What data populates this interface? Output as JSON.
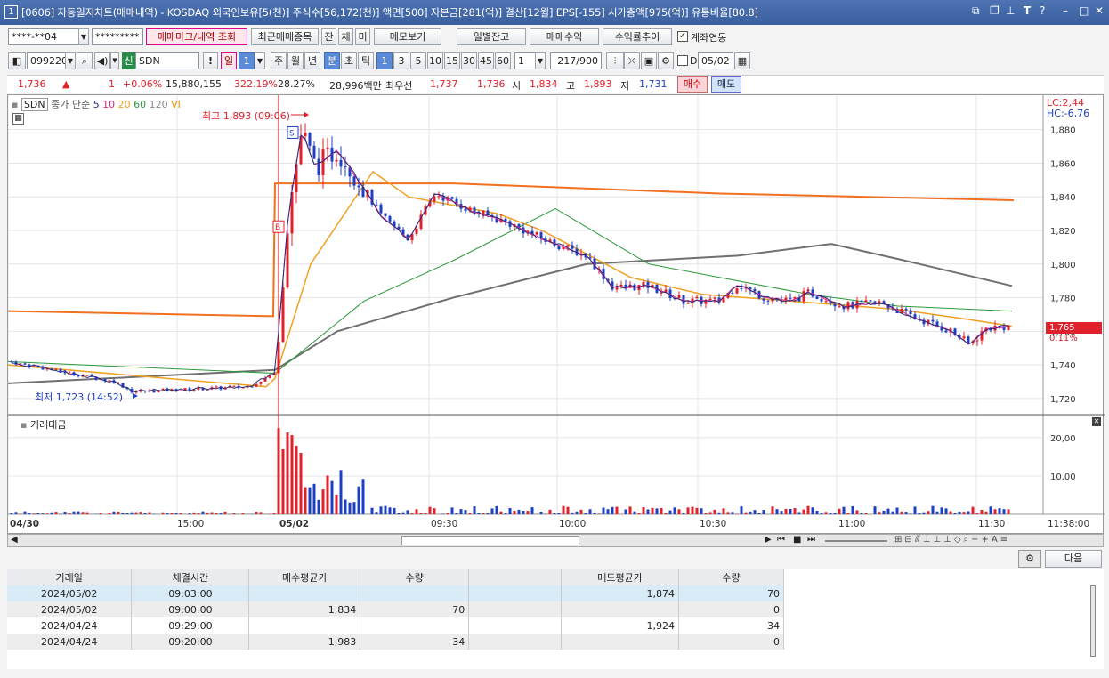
{
  "window": {
    "number": "1",
    "title": "[0606] 자동일지차트(매매내역) - KOSDAQ 외국인보유[5(천)] 주식수[56,172(천)] 액면[500] 자본금[281(억)] 결산[12월] EPS[-155] 시가총액[975(억)] 유통비율[80.8]"
  },
  "toolbar1": {
    "account": "****-**04",
    "password": "*********",
    "trade_mark_btn": "매매마크/내역 조회",
    "recent_btn": "최근매매종목",
    "jan": "잔",
    "che": "체",
    "mi": "미",
    "memo_btn": "메모보기",
    "daily_btn": "일별잔고",
    "profit_btn": "매매수익",
    "ratio_btn": "수익률추이",
    "link_label": "계좌연동"
  },
  "toolbar2": {
    "code": "099220",
    "tag": "신",
    "name": "SDN",
    "excl": "!",
    "periods": [
      "일",
      "1",
      "주",
      "월",
      "년",
      "분",
      "초",
      "틱"
    ],
    "intervals": [
      "1",
      "3",
      "5",
      "10",
      "15",
      "30",
      "45",
      "60"
    ],
    "count": "1",
    "view": "217",
    "total": "/900",
    "date": "05/02"
  },
  "quote": {
    "price": "1,736",
    "arrow": "▲",
    "change": "1",
    "pct": "+0.06%",
    "volume": "15,880,155",
    "vol_ratio": "322.19%",
    "turnover": "28.27%",
    "amount": "28,996백만",
    "best_label": "최우선",
    "ask": "1,737",
    "bid": "1,736",
    "open_label": "시",
    "open": "1,834",
    "high_label": "고",
    "high": "1,893",
    "low_label": "저",
    "low": "1,731",
    "buy_btn": "매수",
    "sell_btn": "매도"
  },
  "legend": {
    "name": "SDN",
    "ma_label": "종가 단순",
    "ma": [
      "5",
      "10",
      "20",
      "60",
      "120"
    ],
    "vi": "VI"
  },
  "annotations": {
    "high": "최고 1,893 (09:06)",
    "low": "최저 1,723 (14:52)",
    "lc": "LC:2,44",
    "hc": "HC:-6,76",
    "cur_price": "1,765",
    "cur_pct": "0.11%",
    "b_mark": "B",
    "s_mark": "S"
  },
  "volume_title": "거래대금",
  "price_ticks": [
    "1,880",
    "1,860",
    "1,840",
    "1,820",
    "1,800",
    "1,780",
    "1,760",
    "1,740",
    "1,720"
  ],
  "vol_ticks": [
    "20,00",
    "10,00"
  ],
  "time_ticks": [
    "04/30",
    "15:00",
    "05/02",
    "09:30",
    "10:00",
    "10:30",
    "11:00",
    "11:30",
    "11:38:00"
  ],
  "colors": {
    "up": "#e0202a",
    "down": "#1d3fc4",
    "ma5": "#2a2a7a",
    "ma10": "#d4298a",
    "ma20": "#f0a020",
    "ma60": "#2a9a3a",
    "ma120": "#707070",
    "upper": "#f07020"
  },
  "chart_data": {
    "type": "candlestick",
    "y_range": [
      1712,
      1892
    ],
    "vol_range": [
      0,
      23
    ],
    "ma120": [
      [
        0,
        1729
      ],
      [
        300,
        1737
      ],
      [
        370,
        1760
      ],
      [
        500,
        1780
      ],
      [
        650,
        1800
      ],
      [
        820,
        1805
      ],
      [
        925,
        1812
      ],
      [
        1000,
        1803
      ],
      [
        1128,
        1787
      ]
    ],
    "ma60": [
      [
        0,
        1742
      ],
      [
        300,
        1735
      ],
      [
        400,
        1778
      ],
      [
        500,
        1802
      ],
      [
        615,
        1833
      ],
      [
        720,
        1800
      ],
      [
        800,
        1792
      ],
      [
        900,
        1782
      ],
      [
        1000,
        1775
      ],
      [
        1128,
        1772
      ]
    ],
    "ma20": [
      [
        0,
        1740
      ],
      [
        290,
        1727
      ],
      [
        300,
        1732
      ],
      [
        340,
        1800
      ],
      [
        410,
        1855
      ],
      [
        450,
        1840
      ],
      [
        550,
        1830
      ],
      [
        600,
        1820
      ],
      [
        700,
        1792
      ],
      [
        780,
        1782
      ],
      [
        880,
        1778
      ],
      [
        1000,
        1773
      ],
      [
        1080,
        1767
      ],
      [
        1128,
        1763
      ]
    ],
    "upper": [
      [
        0,
        1772
      ],
      [
        298,
        1769
      ],
      [
        300,
        1848
      ],
      [
        500,
        1848
      ],
      [
        800,
        1842
      ],
      [
        1130,
        1838
      ]
    ],
    "vol_note": "upper band line"
  },
  "trades": {
    "headers": [
      "거래일",
      "체결시간",
      "매수평균가",
      "수량",
      "",
      "매도평균가",
      "수량"
    ],
    "rows": [
      [
        "2024/05/02",
        "09:03:00",
        "",
        "",
        "",
        "1,874",
        "70"
      ],
      [
        "2024/05/02",
        "09:00:00",
        "1,834",
        "70",
        "",
        "",
        "0"
      ],
      [
        "2024/04/24",
        "09:29:00",
        "",
        "",
        "",
        "1,924",
        "34"
      ],
      [
        "2024/04/24",
        "09:20:00",
        "1,983",
        "34",
        "",
        "",
        "0"
      ]
    ]
  },
  "next_btn": "다음"
}
